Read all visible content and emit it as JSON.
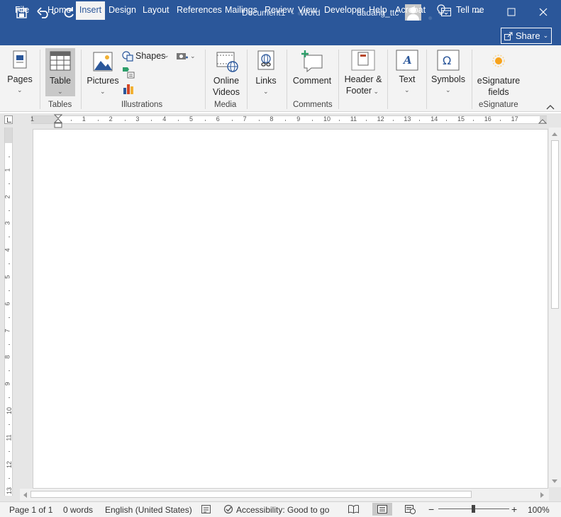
{
  "window": {
    "doc_title": "Document1",
    "separator": "-",
    "app_name": "Word",
    "user_name": "dadang_ttc",
    "qat_icons": [
      "save-icon",
      "undo-icon",
      "redo-icon",
      "customize-qat-icon"
    ],
    "window_icons": [
      "ribbon-display-icon",
      "minimize-icon",
      "maximize-icon",
      "close-icon"
    ]
  },
  "tabs": [
    {
      "label": "File"
    },
    {
      "label": "Home"
    },
    {
      "label": "Insert",
      "active": true
    },
    {
      "label": "Design"
    },
    {
      "label": "Layout"
    },
    {
      "label": "References"
    },
    {
      "label": "Mailings"
    },
    {
      "label": "Review"
    },
    {
      "label": "View"
    },
    {
      "label": "Developer"
    },
    {
      "label": "Help"
    },
    {
      "label": "Acrobat"
    }
  ],
  "tell_me": "Tell me",
  "share": "Share",
  "ribbon": {
    "pages": "Pages",
    "table": "Table",
    "pictures": "Pictures",
    "shapes": "Shapes",
    "online_videos_1": "Online",
    "online_videos_2": "Videos",
    "links": "Links",
    "comment": "Comment",
    "header_footer_1": "Header &",
    "header_footer_2": "Footer",
    "text": "Text",
    "symbols": "Symbols",
    "esignature_1": "eSignature",
    "esignature_2": "fields",
    "groups": {
      "tables": "Tables",
      "illustrations": "Illustrations",
      "media": "Media",
      "comments": "Comments",
      "esignature": "eSignature"
    }
  },
  "ruler": {
    "top_numbers": [
      "1",
      "1",
      "2",
      "3",
      "4",
      "5",
      "6",
      "7",
      "8",
      "9",
      "10",
      "11",
      "12",
      "13",
      "14",
      "15",
      "16",
      "17"
    ],
    "left_numbers": [
      "1",
      "2",
      "3",
      "4",
      "5",
      "6",
      "7",
      "8",
      "9",
      "10",
      "11",
      "12",
      "13"
    ]
  },
  "status": {
    "page": "Page 1 of 1",
    "words": "0 words",
    "language": "English (United States)",
    "accessibility": "Accessibility: Good to go",
    "zoom_minus": "−",
    "zoom_plus": "+",
    "zoom_level": "100%",
    "zoom_fraction": 0.5
  },
  "colors": {
    "title_bar": "#2b579a",
    "ribbon_bg": "#f3f3f3",
    "canvas_bg": "#e6e6e6"
  }
}
